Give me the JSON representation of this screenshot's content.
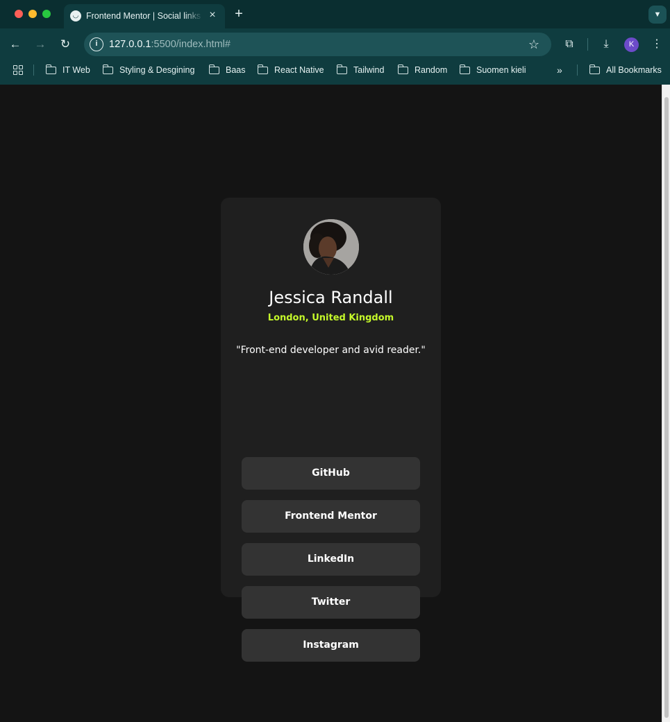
{
  "browser": {
    "tab": {
      "title": "Frontend Mentor | Social links profile",
      "close_icon": "close-icon",
      "favicon_icon": "frontend-mentor-favicon-icon"
    },
    "new_tab_icon": "plus-icon",
    "tab_search_icon": "chevron-down-icon",
    "nav": {
      "back_icon": "arrow-left-icon",
      "forward_icon": "arrow-right-icon",
      "reload_icon": "reload-icon"
    },
    "url": {
      "host": "127.0.0.1",
      "rest": ":5500/index.html#"
    },
    "bookmark_star_icon": "star-icon",
    "extensions_icon": "puzzle-icon",
    "download_icon": "download-icon",
    "profile_initial": "K",
    "menu_icon": "kebab-menu-icon",
    "bookmarks": [
      {
        "label": "IT Web"
      },
      {
        "label": "Styling & Desgining"
      },
      {
        "label": "Baas"
      },
      {
        "label": "React Native"
      },
      {
        "label": "Tailwind"
      },
      {
        "label": "Random"
      },
      {
        "label": "Suomen kieli"
      }
    ],
    "more_bookmarks_icon": "double-chevron-right-icon",
    "all_bookmarks": "All Bookmarks",
    "colors": {
      "chrome": "#0f3c3f",
      "tabstrip": "#0a2e30",
      "omnibox": "#1e5357"
    }
  },
  "profile": {
    "name": "Jessica Randall",
    "location": "London, United Kingdom",
    "bio": "\"Front-end developer and avid reader.\"",
    "links": [
      {
        "label": "GitHub"
      },
      {
        "label": "Frontend Mentor"
      },
      {
        "label": "LinkedIn"
      },
      {
        "label": "Twitter"
      },
      {
        "label": "Instagram"
      }
    ],
    "colors": {
      "background": "#141414",
      "card": "#1f1f1f",
      "button": "#333333",
      "accent": "#c4f82a"
    }
  }
}
